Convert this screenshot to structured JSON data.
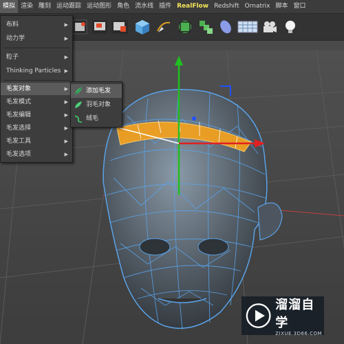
{
  "menubar": {
    "items": [
      "模拟",
      "渲染",
      "雕刻",
      "运动跟踪",
      "运动图形",
      "角色",
      "流水线",
      "插件",
      "RealFlow",
      "Redshift",
      "Ornatrix",
      "脚本",
      "窗口"
    ]
  },
  "dropdown": {
    "items": [
      {
        "label": "布料",
        "arrow": "▶"
      },
      {
        "label": "动力学",
        "arrow": "▶"
      },
      {
        "label": "粒子",
        "arrow": "▶"
      },
      {
        "label": "Thinking Particles",
        "arrow": "▶"
      },
      {
        "label": "毛发对象",
        "arrow": "▶"
      },
      {
        "label": "毛发模式",
        "arrow": "▶"
      },
      {
        "label": "毛发编辑",
        "arrow": "▶"
      },
      {
        "label": "毛发选择",
        "arrow": "▶"
      },
      {
        "label": "毛发工具",
        "arrow": "▶"
      },
      {
        "label": "毛发选项",
        "arrow": "▶"
      }
    ]
  },
  "submenu": {
    "items": [
      {
        "label": "添加毛发",
        "icon": "add-hair-icon"
      },
      {
        "label": "羽毛对象",
        "icon": "feather-icon"
      },
      {
        "label": "绒毛",
        "icon": "fur-icon"
      }
    ]
  },
  "toolbar": {
    "icons": [
      "cube-icon",
      "pen-spline-icon",
      "subdivision-icon",
      "array-icon",
      "deformer-icon",
      "floor-grid-icon",
      "camera-icon",
      "light-bulb-icon"
    ]
  },
  "watermark": {
    "name": "溜溜自学",
    "url": "ZIXUE.3D66.COM"
  },
  "colors": {
    "accent": "#f3e55a",
    "wire": "#5aa3e8",
    "selection": "#f0a020",
    "axis_x": "#e02020",
    "axis_y": "#20c020",
    "axis_z": "#2050ff"
  }
}
